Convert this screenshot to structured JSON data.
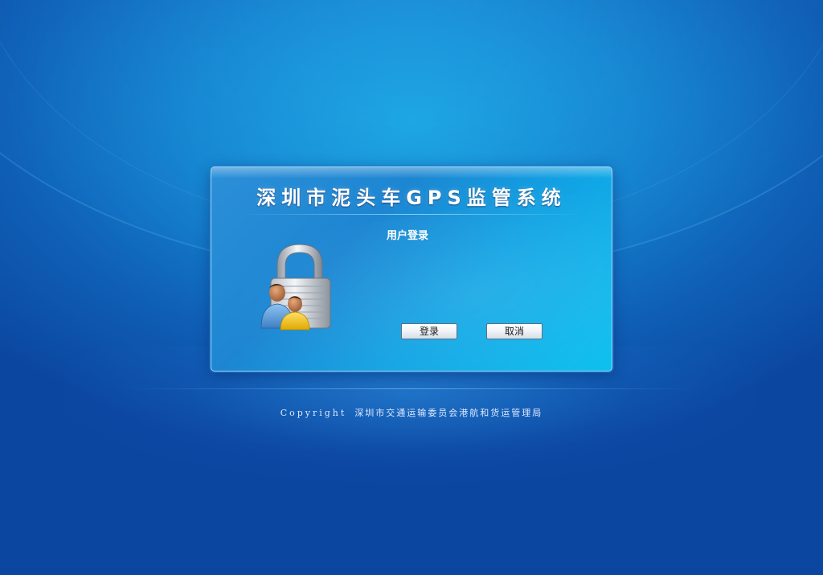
{
  "app": {
    "title": "深圳市泥头车GPS监管系统"
  },
  "login": {
    "heading": "用户登录",
    "login_button_label": "登录",
    "cancel_button_label": "取消",
    "icon": "lock-users-icon"
  },
  "footer": {
    "copyright_label": "Copyright",
    "organization": "深圳市交通运输委员会港航和货运管理局"
  },
  "colors": {
    "background": "#0f5fb6",
    "dialog": "#1d86d2",
    "dialog_accent": "#0ec1ef",
    "text": "#ffffff"
  }
}
